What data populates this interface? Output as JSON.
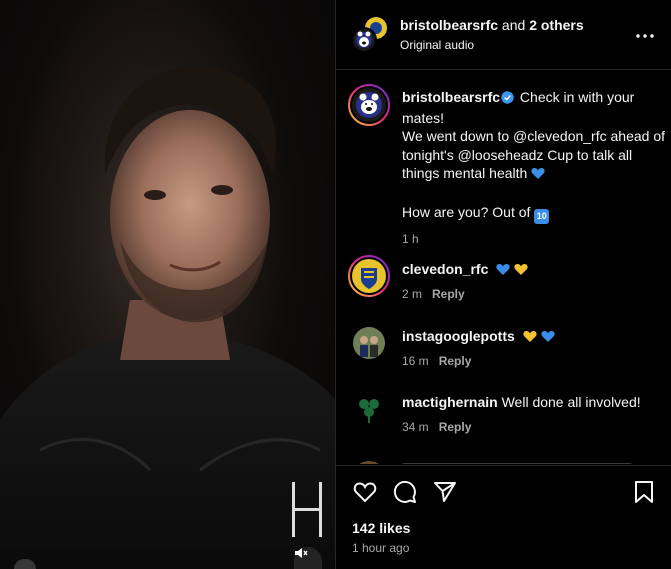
{
  "header": {
    "username": "bristolbearsrfc",
    "connector": " and ",
    "others": "2 others",
    "audio": "Original audio"
  },
  "caption": {
    "username": "bristolbearsrfc",
    "line1": " Check in with your mates!",
    "line2": "We went down to @clevedon_rfc ahead of tonight's @looseheadz Cup to talk all things mental health",
    "line3": "How are you? Out of",
    "badge": "10",
    "time": "1 h"
  },
  "comments": [
    {
      "username": "clevedon_rfc",
      "text": "",
      "time": "2 m",
      "reply": "Reply",
      "avatar_color": "#e7c32c"
    },
    {
      "username": "instagooglepotts",
      "text": "",
      "time": "16 m",
      "reply": "Reply",
      "avatar_color": "#6f7f55"
    },
    {
      "username": "mactighernain",
      "text": "Well done all involved!",
      "time": "34 m",
      "reply": "Reply",
      "avatar_color": "#1b6b3a"
    }
  ],
  "footer": {
    "likes": "142 likes",
    "time_ago": "1 hour ago"
  },
  "colors": {
    "blue_heart": "#3b8ee8",
    "yellow_heart": "#f2c230",
    "verified": "#3897f0",
    "story_ring_start": "#f9ce34",
    "story_ring_mid": "#ee2a7b",
    "story_ring_end": "#6228d7"
  }
}
